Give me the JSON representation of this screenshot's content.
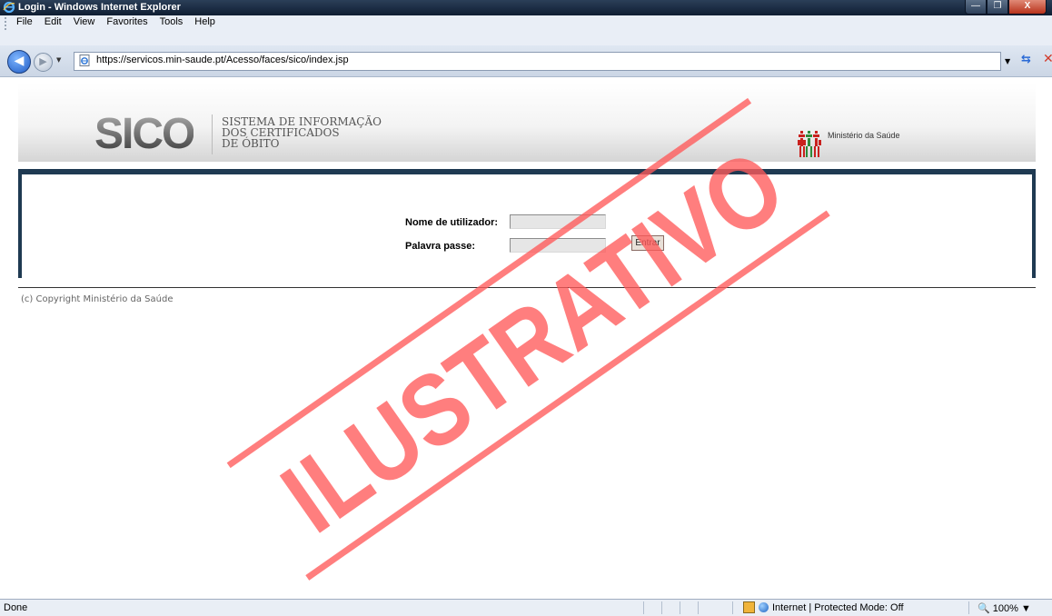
{
  "window": {
    "title": "Login - Windows Internet Explorer",
    "minimize_glyph": "—",
    "maximize_glyph": "❐",
    "close_glyph": "X"
  },
  "menu": {
    "items": [
      "File",
      "Edit",
      "View",
      "Favorites",
      "Tools",
      "Help"
    ]
  },
  "address_bar": {
    "url": "https://servicos.min-saude.pt/Acesso/faces/sico/index.jsp",
    "back_glyph": "◀",
    "forward_glyph": "▶"
  },
  "header": {
    "logo_text": "SICO",
    "subtitle_lines": [
      "SISTEMA DE INFORMAÇÃO",
      "DOS CERTIFICADOS",
      "DE ÓBITO"
    ],
    "ministry_label": "Ministério da Saúde",
    "accent_color": "#1f3a52"
  },
  "login_form": {
    "username_label": "Nome de utilizador:",
    "username_value": "",
    "password_label": "Palavra passe:",
    "password_value": "",
    "submit_label": "Entrar"
  },
  "footer": {
    "copyright": "(c) Copyright Ministério da Saúde"
  },
  "watermark": {
    "text": "ILUSTRATIVO",
    "color": "#ff5a5a"
  },
  "status_bar": {
    "status_text": "Done",
    "zone_text": "Internet | Protected Mode: Off",
    "zoom_text": "100%"
  }
}
